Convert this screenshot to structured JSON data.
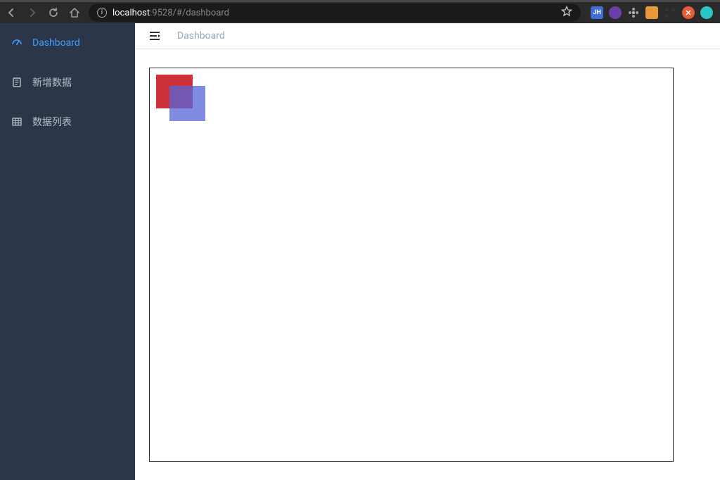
{
  "browser": {
    "url_host": "localhost",
    "url_rest": ":9528/#/dashboard"
  },
  "sidebar": {
    "items": [
      {
        "label": "Dashboard"
      },
      {
        "label": "新增数据"
      },
      {
        "label": "数据列表"
      }
    ]
  },
  "topbar": {
    "breadcrumb": "Dashboard"
  },
  "ext_colors": {
    "jh": "#3f6fd6",
    "purple": "#6a3fa8",
    "flower": "#9aa0a6",
    "orange": "#e89a3a",
    "qr": "#333333",
    "red": "#e45c3a",
    "teal": "#2bc5c3"
  }
}
